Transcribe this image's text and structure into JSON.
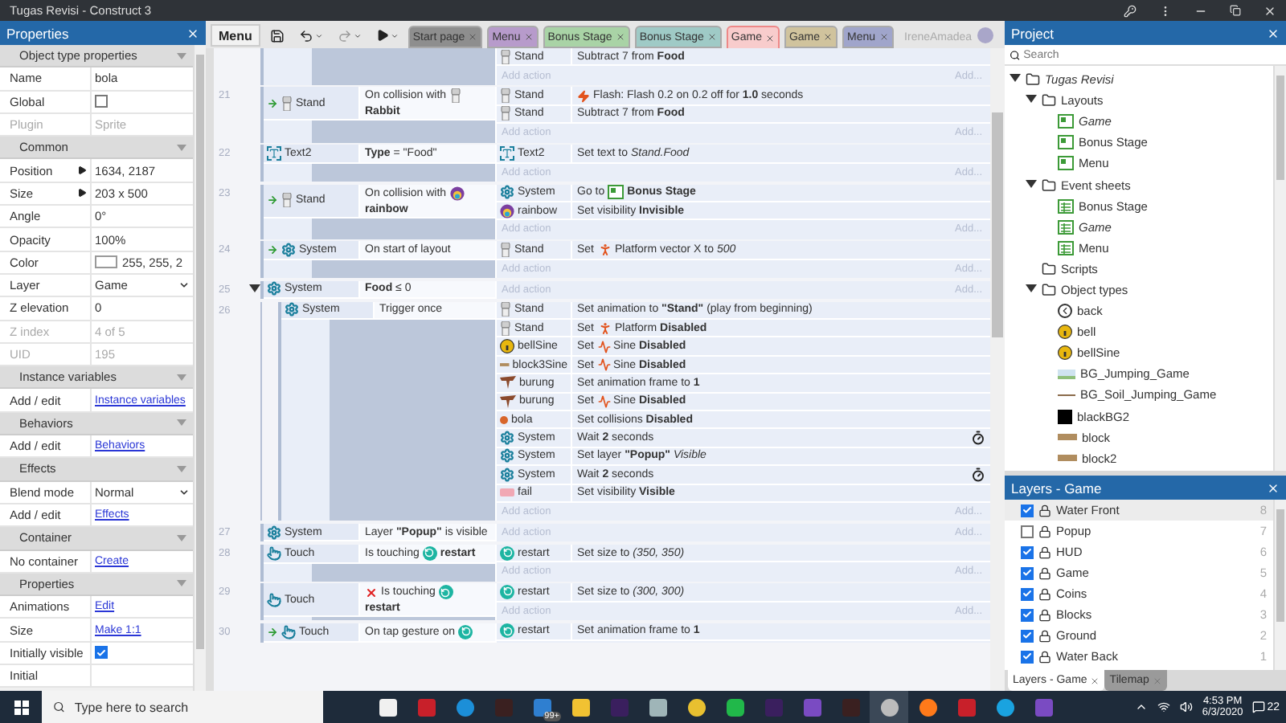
{
  "window": {
    "title": "Tugas Revisi - Construct 3"
  },
  "properties": {
    "title": "Properties",
    "sections": [
      {
        "title": "Object type properties",
        "rows": [
          {
            "label": "Name",
            "kind": "text",
            "value": "bola"
          },
          {
            "label": "Global",
            "kind": "checkbox",
            "checked": false
          },
          {
            "label": "Plugin",
            "kind": "text",
            "value": "Sprite",
            "disabled": true
          }
        ]
      },
      {
        "title": "Common",
        "rows": [
          {
            "label": "Position",
            "kind": "expand",
            "value": "1634, 2187"
          },
          {
            "label": "Size",
            "kind": "expand",
            "value": "203 x 500"
          },
          {
            "label": "Angle",
            "kind": "text",
            "value": "0°"
          },
          {
            "label": "Opacity",
            "kind": "text",
            "value": "100%"
          },
          {
            "label": "Color",
            "kind": "color",
            "value": "255, 255, 2"
          },
          {
            "label": "Layer",
            "kind": "dropdown",
            "value": "Game"
          },
          {
            "label": "Z elevation",
            "kind": "text",
            "value": "0"
          },
          {
            "label": "Z index",
            "kind": "text",
            "value": "4 of 5",
            "disabled": true
          },
          {
            "label": "UID",
            "kind": "text",
            "value": "195",
            "disabled": true
          }
        ]
      },
      {
        "title": "Instance variables",
        "rows": [
          {
            "label": "Add / edit",
            "kind": "link",
            "value": "Instance variables"
          }
        ]
      },
      {
        "title": "Behaviors",
        "rows": [
          {
            "label": "Add / edit",
            "kind": "link",
            "value": "Behaviors"
          }
        ]
      },
      {
        "title": "Effects",
        "rows": [
          {
            "label": "Blend mode",
            "kind": "dropdown",
            "value": "Normal"
          },
          {
            "label": "Add / edit",
            "kind": "link",
            "value": "Effects"
          }
        ]
      },
      {
        "title": "Container",
        "rows": [
          {
            "label": "No container",
            "kind": "link",
            "value": "Create"
          }
        ]
      },
      {
        "title": "Properties",
        "rows": [
          {
            "label": "Animations",
            "kind": "link",
            "value": "Edit"
          },
          {
            "label": "Size",
            "kind": "link",
            "value": "Make 1:1"
          },
          {
            "label": "Initially visible",
            "kind": "checkbox",
            "checked": true
          },
          {
            "label": "Initial",
            "kind": "text"
          }
        ]
      }
    ]
  },
  "toolbar": {
    "menu_label": "Menu"
  },
  "tabs": [
    {
      "label": "Start page",
      "color": "#8e8e8e",
      "selected": false
    },
    {
      "label": "Menu",
      "color": "#b79bcb",
      "selected": false
    },
    {
      "label": "Bonus Stage",
      "color": "#a9d3a6",
      "selected": false
    },
    {
      "label": "Bonus Stage",
      "color": "#9fcac6",
      "selected": false
    },
    {
      "label": "Game",
      "color": "#f8cccc",
      "selected": true
    },
    {
      "label": "Game",
      "color": "#d0c39d",
      "selected": false
    },
    {
      "label": "Menu",
      "color": "#a0a5cb",
      "selected": false
    }
  ],
  "user": {
    "name": "IreneAmadea"
  },
  "events": [
    {
      "actions": [
        {
          "kind": "sprite",
          "object": "Stand",
          "wait": false,
          "parts": [
            {
              "kind": "text",
              "text": "Subtract 7 from **Food**"
            }
          ]
        }
      ],
      "add_action": "Add action",
      "add_more": "Add..."
    },
    {
      "number": "21",
      "conditions": [
        {
          "kind": "sprite",
          "object": "Stand",
          "trigger": true,
          "inverted": false,
          "parts": [
            {
              "kind": "text",
              "text": "On collision with"
            },
            {
              "kind": "figure"
            },
            {
              "kind": "text",
              "text": "**Rabbit**"
            }
          ]
        }
      ],
      "actions": [
        {
          "kind": "sprite",
          "object": "Stand",
          "wait": false,
          "parts": [
            {
              "kind": "flash"
            },
            {
              "kind": "text",
              "text": "Flash: Flash 0.2 on 0.2 off for **1.0** seconds"
            }
          ]
        },
        {
          "kind": "sprite",
          "object": "Stand",
          "wait": false,
          "parts": [
            {
              "kind": "text",
              "text": "Subtract 7 from **Food**"
            }
          ]
        }
      ],
      "add_action": "Add action",
      "add_more": "Add..."
    },
    {
      "number": "22",
      "conditions": [
        {
          "kind": "text",
          "object": "Text2",
          "trigger": false,
          "inverted": false,
          "parts": [
            {
              "kind": "text",
              "text": "**Type** = \"Food\""
            }
          ]
        }
      ],
      "actions": [
        {
          "kind": "text",
          "object": "Text2",
          "wait": false,
          "parts": [
            {
              "kind": "text",
              "text": "Set text to *Stand.Food*"
            }
          ]
        }
      ],
      "add_action": "Add action",
      "add_more": "Add..."
    },
    {
      "number": "23",
      "conditions": [
        {
          "kind": "sprite",
          "object": "Stand",
          "trigger": true,
          "inverted": false,
          "parts": [
            {
              "kind": "text",
              "text": "On collision with"
            },
            {
              "kind": "rainbow"
            },
            {
              "kind": "text",
              "text": "**rainbow**"
            }
          ]
        }
      ],
      "actions": [
        {
          "kind": "system",
          "object": "System",
          "wait": false,
          "parts": [
            {
              "kind": "text",
              "text": "Go to"
            },
            {
              "kind": "layout"
            },
            {
              "kind": "text",
              "text": "**Bonus Stage**"
            }
          ]
        },
        {
          "kind": "rainbow",
          "object": "rainbow",
          "wait": false,
          "parts": [
            {
              "kind": "text",
              "text": "Set visibility **Invisible**"
            }
          ]
        }
      ],
      "add_action": "Add action",
      "add_more": "Add..."
    },
    {
      "number": "24",
      "conditions": [
        {
          "kind": "system",
          "object": "System",
          "trigger": true,
          "inverted": false,
          "parts": [
            {
              "kind": "text",
              "text": "On start of layout"
            }
          ]
        }
      ],
      "actions": [
        {
          "kind": "sprite",
          "object": "Stand",
          "wait": false,
          "parts": [
            {
              "kind": "text",
              "text": "Set"
            },
            {
              "kind": "platform"
            },
            {
              "kind": "text",
              "text": "Platform vector X to *500*"
            }
          ]
        }
      ],
      "add_action": "Add action",
      "add_more": "Add..."
    },
    {
      "number": "25",
      "expanded": true,
      "conditions": [
        {
          "kind": "system",
          "object": "System",
          "trigger": false,
          "inverted": false,
          "parts": [
            {
              "kind": "text",
              "text": "**Food** ≤ 0"
            }
          ]
        }
      ],
      "add_action": "Add action",
      "add_more": "Add...",
      "children": [
        {
          "number": "26",
          "conditions": [
            {
              "kind": "system",
              "object": "System",
              "trigger": false,
              "inverted": false,
              "parts": [
                {
                  "kind": "text",
                  "text": "Trigger once"
                }
              ]
            }
          ],
          "actions": [
            {
              "kind": "sprite",
              "object": "Stand",
              "wait": false,
              "parts": [
                {
                  "kind": "text",
                  "text": "Set animation to **\"Stand\"** (play from beginning)"
                }
              ]
            },
            {
              "kind": "sprite",
              "object": "Stand",
              "wait": false,
              "parts": [
                {
                  "kind": "text",
                  "text": "Set"
                },
                {
                  "kind": "platform"
                },
                {
                  "kind": "text",
                  "text": "Platform **Disabled**"
                }
              ]
            },
            {
              "kind": "bell",
              "object": "bellSine",
              "wait": false,
              "parts": [
                {
                  "kind": "text",
                  "text": "Set"
                },
                {
                  "kind": "sine"
                },
                {
                  "kind": "text",
                  "text": "Sine **Disabled**"
                }
              ]
            },
            {
              "kind": "block",
              "object": "block3Sine",
              "wait": false,
              "parts": [
                {
                  "kind": "text",
                  "text": "Set"
                },
                {
                  "kind": "sine"
                },
                {
                  "kind": "text",
                  "text": "Sine **Disabled**"
                }
              ]
            },
            {
              "kind": "bird",
              "object": "burung",
              "wait": false,
              "parts": [
                {
                  "kind": "text",
                  "text": "Set animation frame to **1**"
                }
              ]
            },
            {
              "kind": "bird",
              "object": "burung",
              "wait": false,
              "parts": [
                {
                  "kind": "text",
                  "text": "Set"
                },
                {
                  "kind": "sine"
                },
                {
                  "kind": "text",
                  "text": "Sine **Disabled**"
                }
              ]
            },
            {
              "kind": "ball",
              "object": "bola",
              "wait": false,
              "parts": [
                {
                  "kind": "text",
                  "text": "Set collisions **Disabled**"
                }
              ]
            },
            {
              "kind": "system",
              "object": "System",
              "wait": true,
              "parts": [
                {
                  "kind": "text",
                  "text": "Wait **2** seconds"
                }
              ]
            },
            {
              "kind": "system",
              "object": "System",
              "wait": false,
              "parts": [
                {
                  "kind": "text",
                  "text": "Set layer **\"Popup\"** *Visible*"
                }
              ]
            },
            {
              "kind": "system",
              "object": "System",
              "wait": true,
              "parts": [
                {
                  "kind": "text",
                  "text": "Wait **2** seconds"
                }
              ]
            },
            {
              "kind": "fail",
              "object": "fail",
              "wait": false,
              "parts": [
                {
                  "kind": "text",
                  "text": "Set visibility **Visible**"
                }
              ]
            }
          ],
          "add_action": "Add action",
          "add_more": "Add..."
        }
      ]
    },
    {
      "number": "27",
      "conditions": [
        {
          "kind": "system",
          "object": "System",
          "trigger": false,
          "inverted": false,
          "parts": [
            {
              "kind": "text",
              "text": "Layer **\"Popup\"** is visible"
            }
          ]
        }
      ],
      "add_action": "Add action",
      "add_more": "Add..."
    },
    {
      "number": "28",
      "conditions": [
        {
          "kind": "touch",
          "object": "Touch",
          "trigger": false,
          "inverted": false,
          "parts": [
            {
              "kind": "text",
              "text": "Is touching"
            },
            {
              "kind": "restart"
            },
            {
              "kind": "text",
              "text": "**restart**"
            }
          ]
        }
      ],
      "actions": [
        {
          "kind": "restart",
          "object": "restart",
          "wait": false,
          "parts": [
            {
              "kind": "text",
              "text": "Set size to *(350, 350)*"
            }
          ]
        }
      ],
      "add_action": "Add action",
      "add_more": "Add..."
    },
    {
      "number": "29",
      "conditions": [
        {
          "kind": "touch",
          "object": "Touch",
          "trigger": false,
          "inverted": true,
          "parts": [
            {
              "kind": "text",
              "text": "Is touching"
            },
            {
              "kind": "restart"
            },
            {
              "kind": "text",
              "text": "**restart**"
            }
          ]
        }
      ],
      "actions": [
        {
          "kind": "restart",
          "object": "restart",
          "wait": false,
          "parts": [
            {
              "kind": "text",
              "text": "Set size to *(300, 300)*"
            }
          ]
        }
      ],
      "add_action": "Add action",
      "add_more": "Add..."
    },
    {
      "number": "30",
      "conditions": [
        {
          "kind": "touch",
          "object": "Touch",
          "trigger": true,
          "inverted": false,
          "parts": [
            {
              "kind": "text",
              "text": "On tap gesture on"
            },
            {
              "kind": "restart"
            }
          ]
        }
      ],
      "actions": [
        {
          "kind": "restart",
          "object": "restart",
          "wait": false,
          "parts": [
            {
              "kind": "text",
              "text": "Set animation frame to **1**"
            }
          ]
        }
      ]
    }
  ],
  "project": {
    "title": "Project",
    "search": {
      "placeholder": "Search"
    },
    "tree": [
      {
        "label": "Tugas Revisi",
        "kind": "folder",
        "italic": true,
        "expanded": true,
        "children": [
          {
            "label": "Layouts",
            "kind": "folder",
            "italic": false,
            "expanded": true,
            "children": [
              {
                "label": "Game",
                "kind": "layout",
                "italic": true
              },
              {
                "label": "Bonus Stage",
                "kind": "layout",
                "italic": false
              },
              {
                "label": "Menu",
                "kind": "layout",
                "italic": false
              }
            ]
          },
          {
            "label": "Event sheets",
            "kind": "folder",
            "italic": false,
            "expanded": true,
            "children": [
              {
                "label": "Bonus Stage",
                "kind": "sheet",
                "italic": false
              },
              {
                "label": "Game",
                "kind": "sheet",
                "italic": true
              },
              {
                "label": "Menu",
                "kind": "sheet",
                "italic": false
              }
            ]
          },
          {
            "label": "Scripts",
            "kind": "folder",
            "italic": false
          },
          {
            "label": "Object types",
            "kind": "folder",
            "italic": false,
            "expanded": true,
            "children": [
              {
                "label": "back",
                "kind": "back",
                "italic": false
              },
              {
                "label": "bell",
                "kind": "bell",
                "italic": false
              },
              {
                "label": "bellSine",
                "kind": "bell",
                "italic": false
              },
              {
                "label": "BG_Jumping_Game",
                "kind": "image",
                "italic": false
              },
              {
                "label": "BG_Soil_Jumping_Game",
                "kind": "line",
                "italic": false
              },
              {
                "label": "blackBG2",
                "kind": "black",
                "italic": false
              },
              {
                "label": "block",
                "kind": "block",
                "italic": false
              },
              {
                "label": "block2",
                "kind": "block",
                "italic": false
              }
            ]
          }
        ]
      }
    ]
  },
  "layers": {
    "title": "Layers - Game",
    "items": [
      {
        "name": "Water Front",
        "visible": true,
        "index": "8",
        "selected": true
      },
      {
        "name": "Popup",
        "visible": false,
        "index": "7",
        "selected": false
      },
      {
        "name": "HUD",
        "visible": true,
        "index": "6",
        "selected": false
      },
      {
        "name": "Game",
        "visible": true,
        "index": "5",
        "selected": false
      },
      {
        "name": "Coins",
        "visible": true,
        "index": "4",
        "selected": false
      },
      {
        "name": "Blocks",
        "visible": true,
        "index": "3",
        "selected": false
      },
      {
        "name": "Ground",
        "visible": true,
        "index": "2",
        "selected": false
      },
      {
        "name": "Water Back",
        "visible": true,
        "index": "1",
        "selected": false
      }
    ],
    "tabs": [
      {
        "label": "Layers - Game",
        "selected": true
      },
      {
        "label": "Tilemap",
        "selected": false
      }
    ]
  },
  "taskbar": {
    "search_placeholder": "Type here to search",
    "apps": [
      {
        "kind": "store"
      },
      {
        "kind": "red"
      },
      {
        "kind": "edge"
      },
      {
        "kind": "dark"
      },
      {
        "kind": "mail",
        "badge": "99+"
      },
      {
        "kind": "files"
      },
      {
        "kind": "purple"
      },
      {
        "kind": "grey"
      },
      {
        "kind": "chrome"
      },
      {
        "kind": "green"
      },
      {
        "kind": "purple"
      },
      {
        "kind": "violet"
      },
      {
        "kind": "dark"
      },
      {
        "kind": "active"
      },
      {
        "kind": "firefox"
      },
      {
        "kind": "red"
      },
      {
        "kind": "skype"
      },
      {
        "kind": "violet"
      }
    ],
    "time": "4:53 PM",
    "date": "6/3/2020",
    "notifications": "22"
  }
}
